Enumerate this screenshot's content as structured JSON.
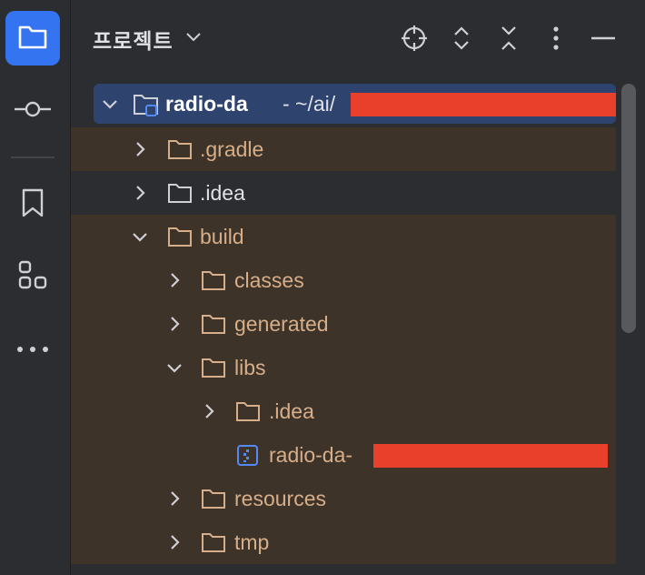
{
  "panel": {
    "title": "프로젝트"
  },
  "toolstrip": {
    "icons": [
      "folder-icon",
      "commit-icon",
      "bookmark-icon",
      "structure-icon",
      "more-icon"
    ]
  },
  "header_actions": [
    "target-icon",
    "expand-collapse-icon",
    "collapse-all-icon",
    "more-vert-icon",
    "minimize-icon"
  ],
  "tree": {
    "root": {
      "name": "radio-da",
      "path": "- ~/ai/"
    },
    "items": [
      {
        "label": ".gradle"
      },
      {
        "label": ".idea"
      },
      {
        "label": "build"
      },
      {
        "label": "classes"
      },
      {
        "label": "generated"
      },
      {
        "label": "libs"
      },
      {
        "label": ".idea"
      },
      {
        "label": "radio-da-"
      },
      {
        "label": "resources"
      },
      {
        "label": "tmp"
      }
    ]
  },
  "colors": {
    "accent": "#3574f0",
    "excluded_bg": "#3e3328",
    "excluded_text": "#d7ae8a",
    "selected_bg": "#2e436e",
    "redaction": "#e8402b"
  }
}
